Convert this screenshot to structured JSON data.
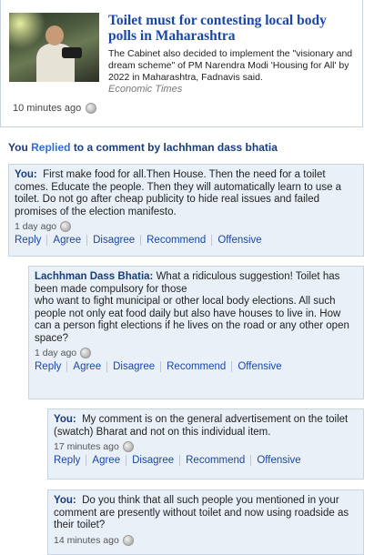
{
  "news": {
    "headline": "Toilet must for contesting local body polls in Maharashtra",
    "summary": "The Cabinet also decided to implement the \"visionary and dream scheme\" of PM Narendra Modi 'Housing for All' by 2022 in Maharashtra, Fadnavis said.",
    "source": "Economic Times",
    "time": "10 minutes ago"
  },
  "activity": {
    "you": "You",
    "replied": "Replied",
    "mid": "to a comment by",
    "user": "lachhman dass bhatia"
  },
  "comments": [
    {
      "author": "You:",
      "text": "First make food for all.Then House. Then the need for a toilet comes. Educate the people. Then they will automatically learn to use a toilet. Do not go after cheap publicity to hide real issues and failed promises of the election manifesto.",
      "time": "1 day ago",
      "actions": [
        "Reply",
        "Agree",
        "Disagree",
        "Recommend",
        "Offensive"
      ]
    },
    {
      "author": "Lachhman Dass Bhatia:",
      "text": "What a ridiculous suggestion! Toilet has been made compulsory for those\nwho want to fight municipal or other local body elections. All such people not only eat food daily but also have houses to live in. How\ncan a person fight elections if he lives on the road or any other open space?",
      "time": "1 day ago",
      "actions": [
        "Reply",
        "Agree",
        "Disagree",
        "Recommend",
        "Offensive"
      ]
    },
    {
      "author": "You:",
      "text": "My comment is on the general advertisement on the toilet (swatch) Bharat and not on this individual item.",
      "time": "17 minutes ago",
      "actions": [
        "Reply",
        "Agree",
        "Disagree",
        "Recommend",
        "Offensive"
      ]
    },
    {
      "author": "You:",
      "text": "Do you think that all such people you mentioned in your comment are presently without toilet and now using roadside as their toilet?",
      "time": "14 minutes ago",
      "actions": []
    }
  ],
  "icons": {
    "time_icon": "globe-icon",
    "thumbnail": "news-thumbnail-image"
  },
  "colors": {
    "link": "#1a47a7",
    "comment_bg": "#e9f0f8",
    "comment_border": "#c7d4e2"
  }
}
